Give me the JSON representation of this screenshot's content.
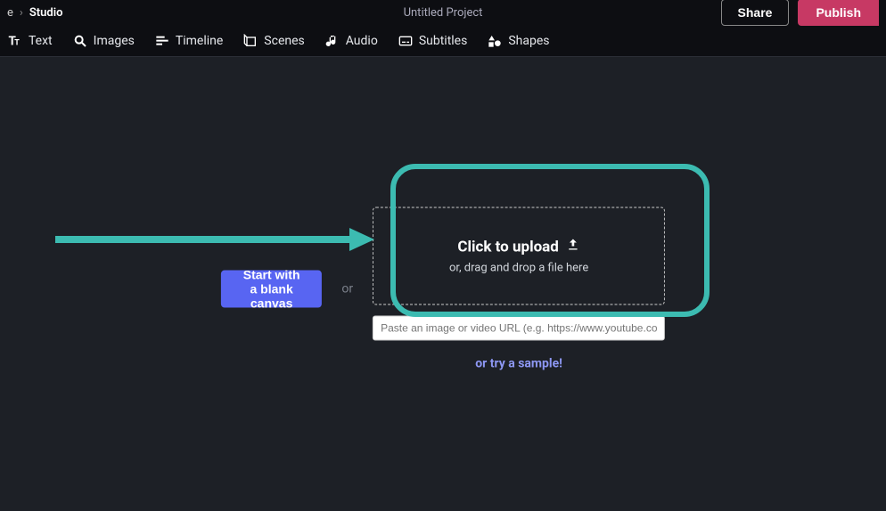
{
  "breadcrumb": {
    "pre": "",
    "item1_suffix": "e",
    "item2": "Studio"
  },
  "project_title": "Untitled Project",
  "actions": {
    "share": "Share",
    "publish": "Publish"
  },
  "toolbar": {
    "text": "Text",
    "images": "Images",
    "timeline": "Timeline",
    "scenes": "Scenes",
    "audio": "Audio",
    "subtitles": "Subtitles",
    "shapes": "Shapes"
  },
  "main": {
    "blank_canvas": "Start with a blank canvas",
    "or": "or",
    "upload_title": "Click to upload",
    "upload_subtitle": "or, drag and drop a file here",
    "url_placeholder": "Paste an image or video URL (e.g. https://www.youtube.com/",
    "sample_link": "or try a sample!"
  }
}
